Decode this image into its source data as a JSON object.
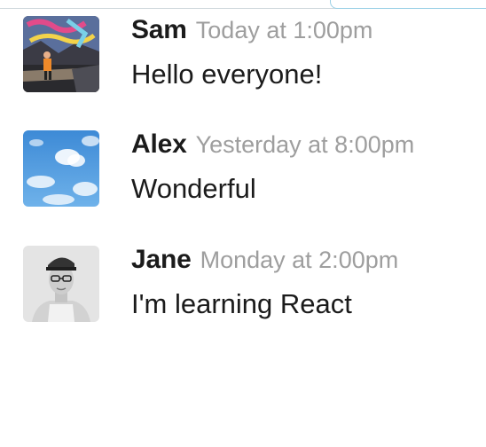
{
  "comments": [
    {
      "author": "Sam",
      "date": "Today at 1:00pm",
      "text": "Hello everyone!",
      "avatar": "avatar-graffiti-photo"
    },
    {
      "author": "Alex",
      "date": "Yesterday at 8:00pm",
      "text": "Wonderful",
      "avatar": "avatar-sky-photo"
    },
    {
      "author": "Jane",
      "date": "Monday at 2:00pm",
      "text": "I'm learning React",
      "avatar": "avatar-portrait-photo"
    }
  ]
}
